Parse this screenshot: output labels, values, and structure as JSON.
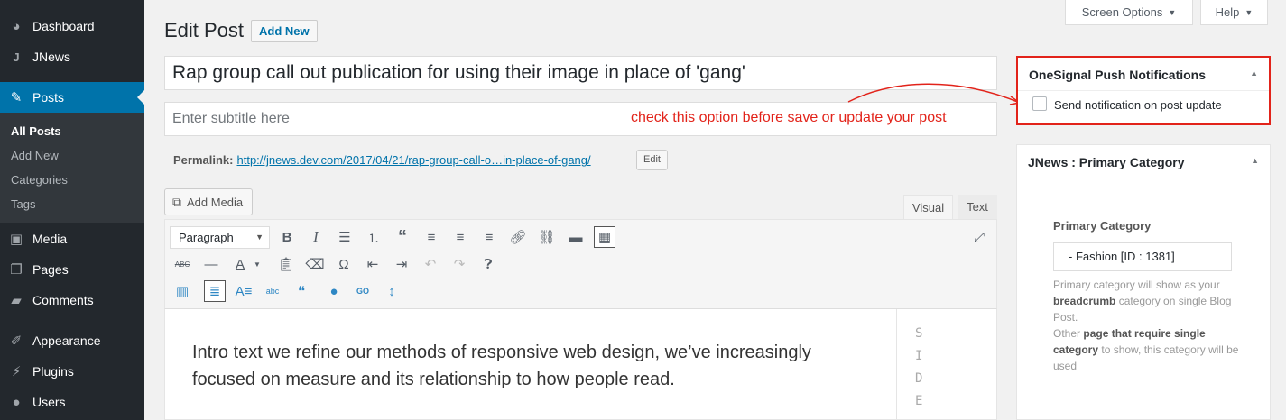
{
  "sidebar": {
    "items": [
      {
        "label": "Dashboard",
        "icon": "dashboard-icon"
      },
      {
        "label": "JNews",
        "icon": "jnews-icon"
      },
      {
        "label": "Posts",
        "icon": "pin-icon"
      },
      {
        "label": "Media",
        "icon": "media-icon"
      },
      {
        "label": "Pages",
        "icon": "pages-icon"
      },
      {
        "label": "Comments",
        "icon": "comments-icon"
      },
      {
        "label": "Appearance",
        "icon": "appearance-icon"
      },
      {
        "label": "Plugins",
        "icon": "plugins-icon"
      },
      {
        "label": "Users",
        "icon": "users-icon"
      }
    ],
    "submenu": [
      "All Posts",
      "Add New",
      "Categories",
      "Tags"
    ]
  },
  "header": {
    "title": "Edit Post",
    "add_new": "Add New",
    "screen_options": "Screen Options",
    "help": "Help"
  },
  "post": {
    "title": "Rap group call out publication for using their image in place of 'gang'",
    "subtitle_placeholder": "Enter subtitle here",
    "annotation": "check this option before save or update your post",
    "permalink_label": "Permalink:",
    "permalink_url": "http://jnews.dev.com/2017/04/21/rap-group-call-o…in-place-of-gang/",
    "edit_label": "Edit"
  },
  "editor": {
    "add_media": "Add Media",
    "tab_visual": "Visual",
    "tab_text": "Text",
    "format": "Paragraph",
    "content": "Intro text we refine our methods of responsive web design, we’ve increasingly focused on measure and its relationship to how people read.",
    "side_letters": [
      "S",
      "I",
      "D",
      "E"
    ]
  },
  "onesignal": {
    "title": "OneSignal Push Notifications",
    "checkbox_label": "Send notification on post update",
    "checked": false
  },
  "jnews_category": {
    "title": "JNews : Primary Category",
    "label": "Primary Category",
    "selected": "-  Fashion  [ID : 1381]",
    "desc1": "Primary category will show as your ",
    "desc_bold1": "breadcrumb",
    "desc2": " category on single Blog Post.",
    "desc3": "Other ",
    "desc_bold2": "page that require single category",
    "desc4": " to show, this category will be used"
  },
  "colors": {
    "sidebar_bg": "#23282d",
    "active": "#0073aa",
    "annotation": "#e2231a"
  }
}
